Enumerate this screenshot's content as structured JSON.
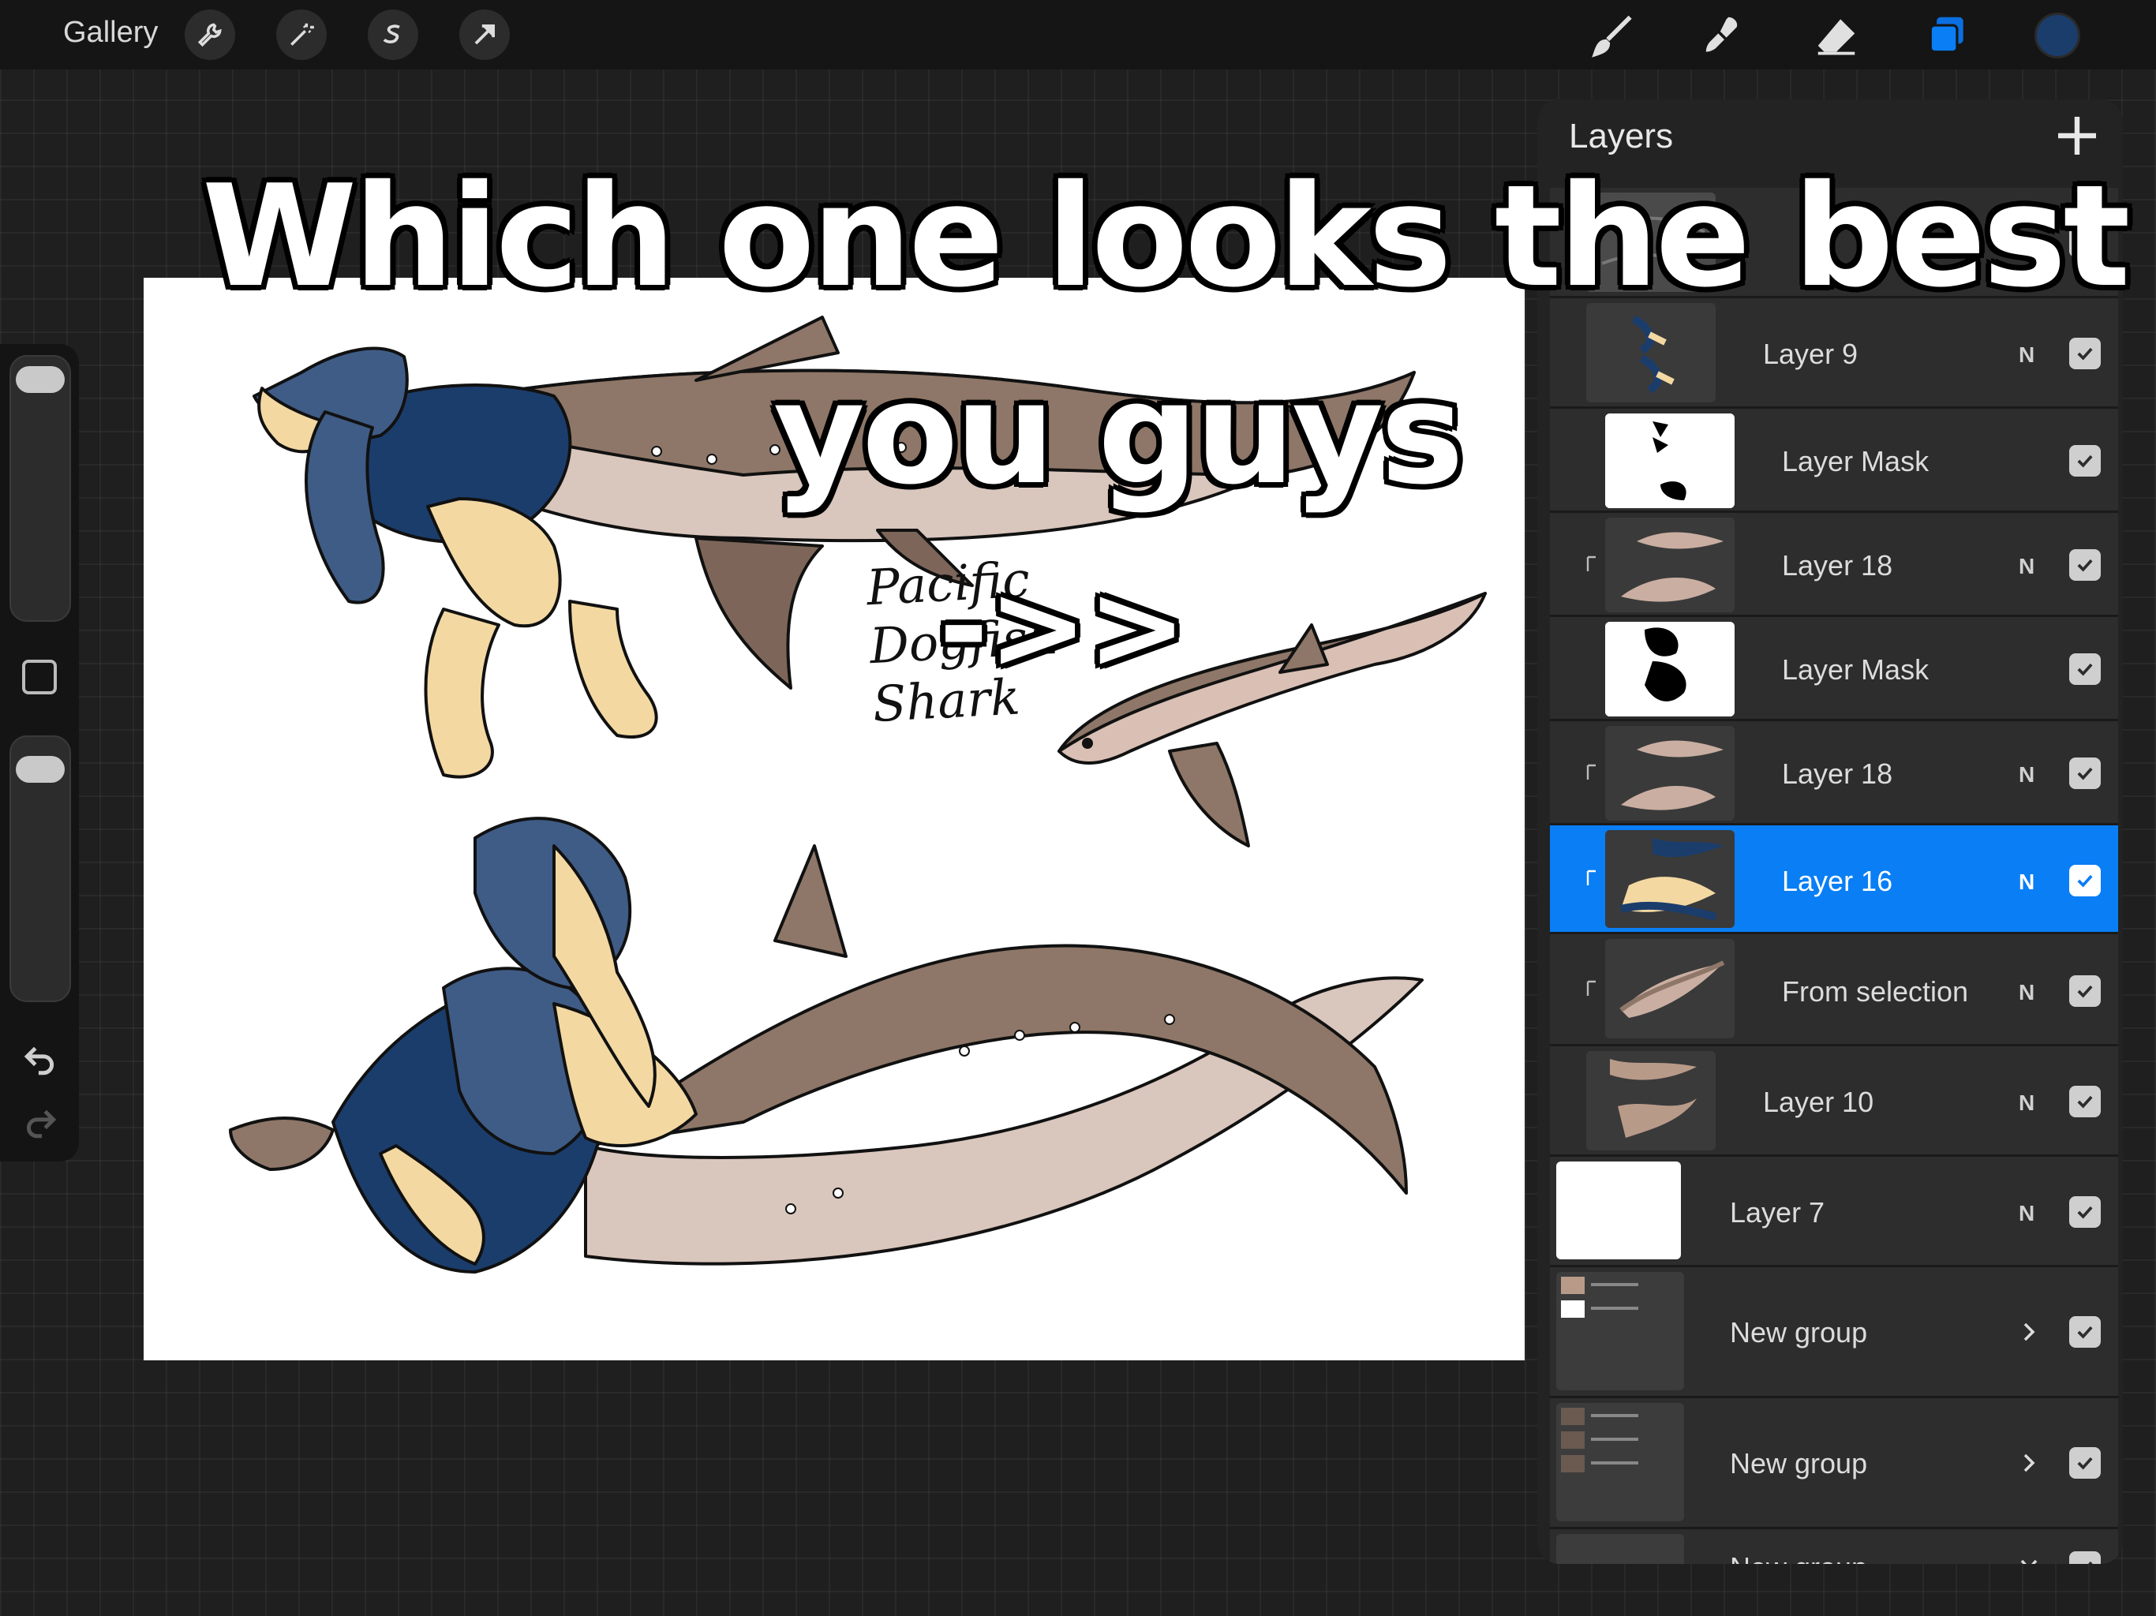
{
  "topbar": {
    "gallery_label": "Gallery",
    "left_tools": [
      "wrench-icon",
      "magic-wand-icon",
      "selection-icon",
      "transform-arrow-icon"
    ],
    "right_tools": [
      "brush-icon",
      "smudge-icon",
      "eraser-icon",
      "layers-icon"
    ],
    "active_color": "#1b3d6c",
    "accent": "#0a7ef5"
  },
  "sidebar": {
    "brush_size_level": 1.0,
    "opacity_level": 1.0
  },
  "canvas": {
    "handwritten_label": "Pacific\nDogfish\nShark"
  },
  "overlay": {
    "line1": "Which one looks the best",
    "line2": "you guys",
    "line3": "->>"
  },
  "layers_panel": {
    "title": "Layers",
    "layers": [
      {
        "name": "",
        "blend": "N",
        "visible": true
      },
      {
        "name": "Layer 9",
        "blend": "N",
        "visible": true
      },
      {
        "name": "Layer Mask",
        "blend": "",
        "visible": true
      },
      {
        "name": "Layer 18",
        "blend": "N",
        "visible": true
      },
      {
        "name": "Layer Mask",
        "blend": "",
        "visible": true
      },
      {
        "name": "Layer 18",
        "blend": "N",
        "visible": true
      },
      {
        "name": "Layer 16",
        "blend": "N",
        "visible": true,
        "selected": true
      },
      {
        "name": "From selection",
        "blend": "N",
        "visible": true
      },
      {
        "name": "Layer 10",
        "blend": "N",
        "visible": true
      },
      {
        "name": "Layer 7",
        "blend": "N",
        "visible": true
      },
      {
        "name": "New group",
        "blend": "",
        "visible": true,
        "group": true
      },
      {
        "name": "New group",
        "blend": "",
        "visible": true,
        "group": true
      },
      {
        "name": "New group",
        "blend": "",
        "visible": true,
        "group": true
      }
    ]
  }
}
